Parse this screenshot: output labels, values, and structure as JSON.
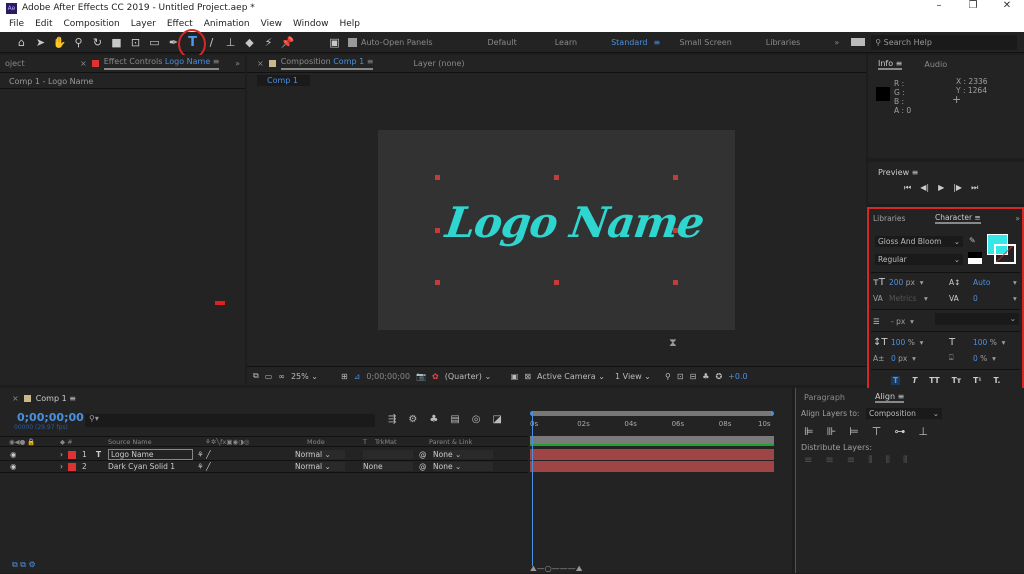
{
  "window": {
    "title": "Adobe After Effects CC 2019 - Untitled Project.aep *",
    "logo": "Ae",
    "minimize": "–",
    "restore": "❐",
    "close": "✕"
  },
  "menu": [
    "File",
    "Edit",
    "Composition",
    "Layer",
    "Effect",
    "Animation",
    "View",
    "Window",
    "Help"
  ],
  "toolbar": {
    "auto_open": "Auto-Open Panels",
    "workspaces": [
      "Default",
      "Learn",
      "Standard",
      "Small Screen",
      "Libraries"
    ],
    "active_workspace": "Standard",
    "more": "»",
    "search_placeholder": "Search Help"
  },
  "left_panel": {
    "project_tab": "oject",
    "tab_prefix": "Effect Controls",
    "tab_layer": "Logo Name",
    "more": "»",
    "subtitle": "Comp 1 - Logo Name"
  },
  "comp_panel": {
    "tab_prefix": "Composition",
    "tab_comp": "Comp 1",
    "layer_tab": "Layer (none)",
    "breadcrumb": "Comp 1",
    "logo_text": "Logo Name",
    "text_color": "#2fd6d0",
    "footer": {
      "zoom": "25%",
      "timecode": "0;00;00;00",
      "resolution": "(Quarter)",
      "camera": "Active Camera",
      "views": "1 View",
      "exposure": "+0.0"
    }
  },
  "info": {
    "tab": "Info",
    "audio_tab": "Audio",
    "r": "R :",
    "g": "G :",
    "b": "B :",
    "a": "A : 0",
    "x": "X : 2336",
    "y": "Y : 1264"
  },
  "preview": {
    "tab": "Preview",
    "controls": [
      "⏮",
      "◀|",
      "▶",
      "|▶",
      "⏭"
    ]
  },
  "character": {
    "libraries_tab": "Libraries",
    "tab": "Character",
    "font": "Gloss And Bloom",
    "style": "Regular",
    "fill_color": "#36e7e7",
    "size": "200",
    "size_unit": "px",
    "leading": "Auto",
    "kerning": "Metrics",
    "tracking": "0",
    "stroke": "-",
    "stroke_unit": "px",
    "vscale": "100",
    "hscale": "100",
    "pct": "%",
    "baseline": "0",
    "baseline_unit": "px",
    "tsume": "0",
    "tsume_unit": "%",
    "styles": [
      "T",
      "T",
      "TT",
      "Tт",
      "T¹",
      "T."
    ]
  },
  "timeline": {
    "tab": "Comp 1",
    "timecode": "0;00;00;00",
    "fps": "00000 (29.97 fps)",
    "columns": {
      "source": "Source Name",
      "mode": "Mode",
      "t": "T",
      "trkmat": "TrkMat",
      "parent": "Parent & Link"
    },
    "layers": [
      {
        "num": "1",
        "type": "T",
        "name": "Logo Name",
        "mode": "Normal",
        "trkmat": "",
        "parent": "None"
      },
      {
        "num": "2",
        "type": "",
        "name": "Dark Cyan Solid 1",
        "mode": "Normal",
        "trkmat": "None",
        "parent": "None"
      }
    ],
    "ruler": [
      "0s",
      "02s",
      "04s",
      "06s",
      "08s",
      "10s"
    ]
  },
  "align": {
    "paragraph_tab": "Paragraph",
    "tab": "Align",
    "align_to_label": "Align Layers to:",
    "align_to": "Composition",
    "distribute": "Distribute Layers:"
  }
}
